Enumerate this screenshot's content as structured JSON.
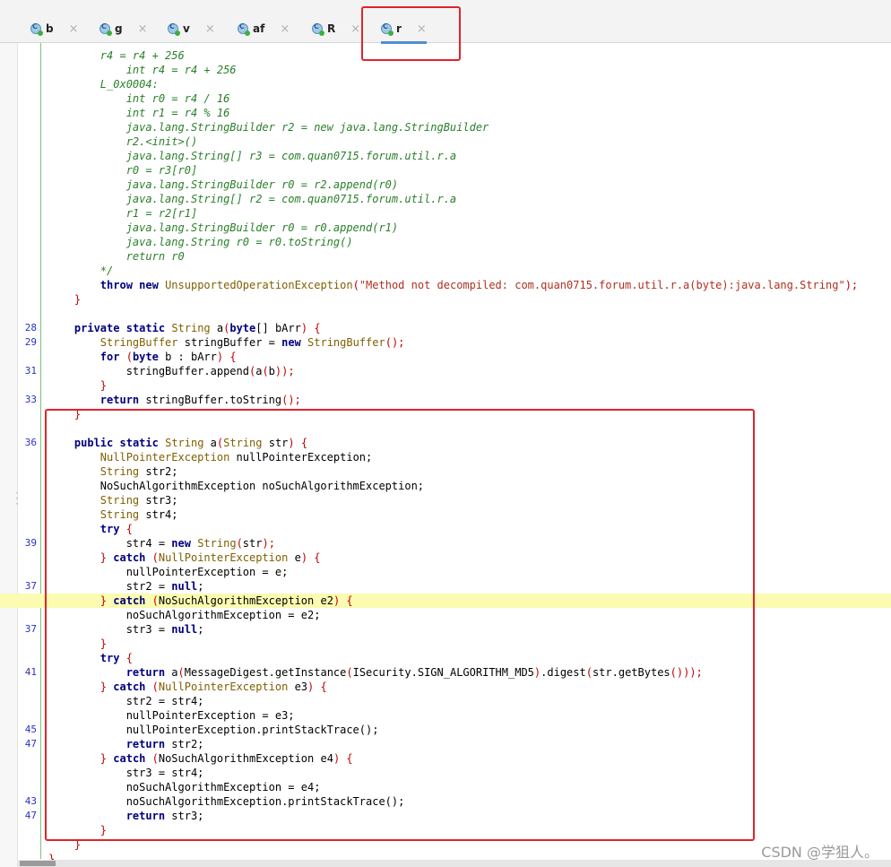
{
  "tabs": [
    {
      "name": "b",
      "icon": "class-icon",
      "active": false
    },
    {
      "name": "g",
      "icon": "class-icon",
      "active": false
    },
    {
      "name": "v",
      "icon": "class-icon",
      "active": false
    },
    {
      "name": "af",
      "icon": "class-icon",
      "active": false
    },
    {
      "name": "R",
      "icon": "class-icon",
      "active": false
    },
    {
      "name": "r",
      "icon": "class-icon",
      "active": true
    }
  ],
  "tab_close_glyph": "×",
  "class_icon_letter": "C",
  "highlight_color": "#fbfbb1",
  "annotation_color": "#e0242b",
  "watermark": "CSDN @学狙人。",
  "lines": [
    {
      "n": "",
      "text": "        r4 = r4 + 256   ",
      "kind": "comment"
    },
    {
      "n": "",
      "text": "            int r4 = r4 + 256",
      "kind": "comment"
    },
    {
      "n": "",
      "text": "        L_0x0004:",
      "kind": "comment"
    },
    {
      "n": "",
      "text": "            int r0 = r4 / 16",
      "kind": "comment"
    },
    {
      "n": "",
      "text": "            int r1 = r4 % 16",
      "kind": "comment"
    },
    {
      "n": "",
      "text": "            java.lang.StringBuilder r2 = new java.lang.StringBuilder",
      "kind": "comment"
    },
    {
      "n": "",
      "text": "            r2.<init>()",
      "kind": "comment"
    },
    {
      "n": "",
      "text": "            java.lang.String[] r3 = com.quan0715.forum.util.r.a",
      "kind": "comment"
    },
    {
      "n": "",
      "text": "            r0 = r3[r0]",
      "kind": "comment"
    },
    {
      "n": "",
      "text": "            java.lang.StringBuilder r0 = r2.append(r0)",
      "kind": "comment"
    },
    {
      "n": "",
      "text": "            java.lang.String[] r2 = com.quan0715.forum.util.r.a",
      "kind": "comment"
    },
    {
      "n": "",
      "text": "            r1 = r2[r1]",
      "kind": "comment"
    },
    {
      "n": "",
      "text": "            java.lang.StringBuilder r0 = r0.append(r1)",
      "kind": "comment"
    },
    {
      "n": "",
      "text": "            java.lang.String r0 = r0.toString()",
      "kind": "comment"
    },
    {
      "n": "",
      "text": "            return r0",
      "kind": "comment"
    },
    {
      "n": "",
      "text": "        */",
      "kind": "comment"
    },
    {
      "n": "",
      "text": "",
      "kind": "throw"
    },
    {
      "n": "",
      "text": "    }",
      "kind": "brace"
    },
    {
      "n": "",
      "text": "",
      "kind": "blank"
    },
    {
      "n": "28",
      "text": "",
      "kind": "sig1"
    },
    {
      "n": "29",
      "text": "",
      "kind": "sb"
    },
    {
      "n": "",
      "text": "",
      "kind": "for"
    },
    {
      "n": "31",
      "text": "",
      "kind": "append"
    },
    {
      "n": "",
      "text": "        }",
      "kind": "brace"
    },
    {
      "n": "33",
      "text": "",
      "kind": "ret1"
    },
    {
      "n": "",
      "text": "    }",
      "kind": "brace"
    },
    {
      "n": "",
      "text": "",
      "kind": "blank"
    },
    {
      "n": "36",
      "text": "",
      "kind": "sig2"
    },
    {
      "n": "",
      "text": "",
      "kind": "decl_npe"
    },
    {
      "n": "",
      "text": "",
      "kind": "decl_str2"
    },
    {
      "n": "",
      "text": "        NoSuchAlgorithmException noSuchAlgorithmException;",
      "kind": "plain"
    },
    {
      "n": "",
      "text": "",
      "kind": "decl_str3"
    },
    {
      "n": "",
      "text": "",
      "kind": "decl_str4"
    },
    {
      "n": "",
      "text": "",
      "kind": "try"
    },
    {
      "n": "39",
      "text": "",
      "kind": "newstr"
    },
    {
      "n": "",
      "text": "",
      "kind": "catch_npe_e"
    },
    {
      "n": "",
      "text": "            nullPointerException = e;",
      "kind": "plain"
    },
    {
      "n": "37",
      "text": "",
      "kind": "str2null"
    },
    {
      "n": "",
      "text": "",
      "kind": "catch_nsa_e2"
    },
    {
      "n": "",
      "text": "            noSuchAlgorithmException = e2;",
      "kind": "plain"
    },
    {
      "n": "37",
      "text": "",
      "kind": "str3null"
    },
    {
      "n": "",
      "text": "        }",
      "kind": "brace"
    },
    {
      "n": "",
      "text": "",
      "kind": "try"
    },
    {
      "n": "41",
      "text": "",
      "kind": "retdigest"
    },
    {
      "n": "",
      "text": "",
      "kind": "catch_npe_e3"
    },
    {
      "n": "",
      "text": "            str2 = str4;",
      "kind": "plain"
    },
    {
      "n": "",
      "text": "            nullPointerException = e3;",
      "kind": "plain"
    },
    {
      "n": "45",
      "text": "            nullPointerException.printStackTrace();",
      "kind": "plain"
    },
    {
      "n": "47",
      "text": "",
      "kind": "retstr2"
    },
    {
      "n": "",
      "text": "",
      "kind": "catch_nsa_e4"
    },
    {
      "n": "",
      "text": "            str3 = str4;",
      "kind": "plain"
    },
    {
      "n": "",
      "text": "            noSuchAlgorithmException = e4;",
      "kind": "plain"
    },
    {
      "n": "43",
      "text": "            noSuchAlgorithmException.printStackTrace();",
      "kind": "plain"
    },
    {
      "n": "47",
      "text": "",
      "kind": "retstr3"
    },
    {
      "n": "",
      "text": "        }",
      "kind": "brace"
    },
    {
      "n": "",
      "text": "    }",
      "kind": "brace"
    },
    {
      "n": "",
      "text": "}",
      "kind": "brace"
    }
  ],
  "highlighted_line_index": 38,
  "strings": {
    "throw_msg": "\"Method not decompiled: com.quan0715.forum.util.r.a(byte):java.lang.String\""
  }
}
